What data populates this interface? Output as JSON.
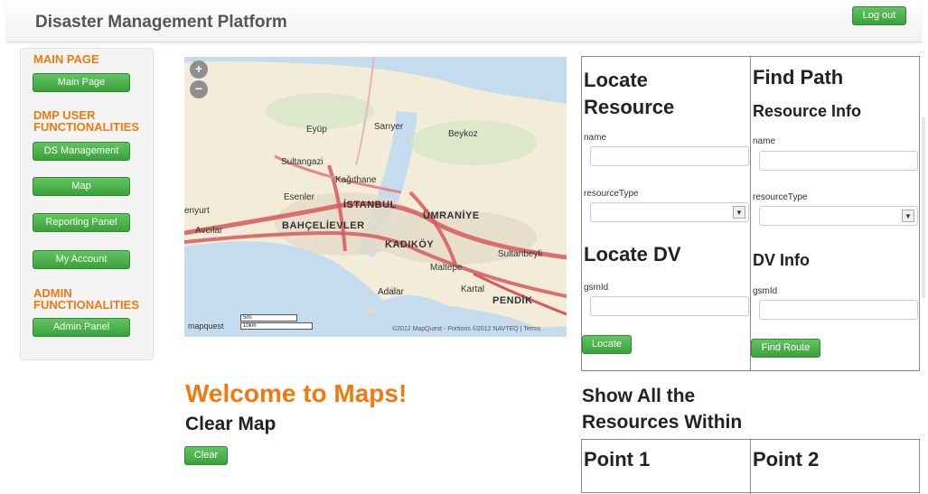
{
  "header": {
    "title": "Disaster Management Platform",
    "logout_label": "Log out"
  },
  "sidebar": {
    "main_heading": "MAIN PAGE",
    "main_page_label": "Main Page",
    "user_heading_1": "DMP USER",
    "user_heading_2": "FUNCTIONALITIES",
    "ds_management_label": "DS Management",
    "map_label": "Map",
    "reporting_label": "Reporting Panel",
    "account_label": "My Account",
    "admin_heading_1": "ADMIN",
    "admin_heading_2": "FUNCTIONALITIES",
    "admin_panel_label": "Admin Panel"
  },
  "map": {
    "zoom_in": "+",
    "zoom_out": "−",
    "labels": {
      "eyup": "Eyüp",
      "sariyer": "Sarıyer",
      "beykoz": "Beykoz",
      "sultangazi": "Sultangazi",
      "kagithane": "Kağıthane",
      "esenler": "Esenler",
      "istanbul": "İSTANBUL",
      "umraniye": "ÜMRANİYE",
      "esenyurt": "enyurt",
      "bahcelievler": "BAHÇELİEVLER",
      "avcilar": "Avcılar",
      "kadikoy": "KADIKÖY",
      "sultanbeyli": "Sultanbeyli",
      "maltepe": "Maltepe",
      "adalar": "Adalar",
      "kartal": "Kartal",
      "pendik": "PENDİK"
    },
    "brand": "mapquest",
    "scale_mi": "5mi",
    "scale_km": "10km",
    "attribution": "©2012 MapQuest - Portions ©2012 NAVTEQ | Terms"
  },
  "welcome": {
    "title": "Welcome to Maps!",
    "clear_heading": "Clear Map",
    "clear_label": "Clear"
  },
  "locate": {
    "title_1": "Locate",
    "title_2": "Resource",
    "name_label": "name",
    "resource_type_label": "resourceType",
    "dv_title": "Locate DV",
    "gsmid_label": "gsmId",
    "button_label": "Locate"
  },
  "path": {
    "title": "Find Path",
    "resource_info": "Resource Info",
    "name_label": "name",
    "resource_type_label": "resourceType",
    "dv_info": "DV Info",
    "gsmid_label": "gsmId",
    "button_label": "Find Route"
  },
  "show_all": {
    "title_1": "Show All the",
    "title_2": "Resources Within",
    "point1": "Point 1",
    "point2": "Point 2"
  },
  "colors": {
    "accent_orange": "#f07a10",
    "button_green": "#4cb04c",
    "highway": "#d65a5a",
    "sea": "#c5dcef"
  }
}
